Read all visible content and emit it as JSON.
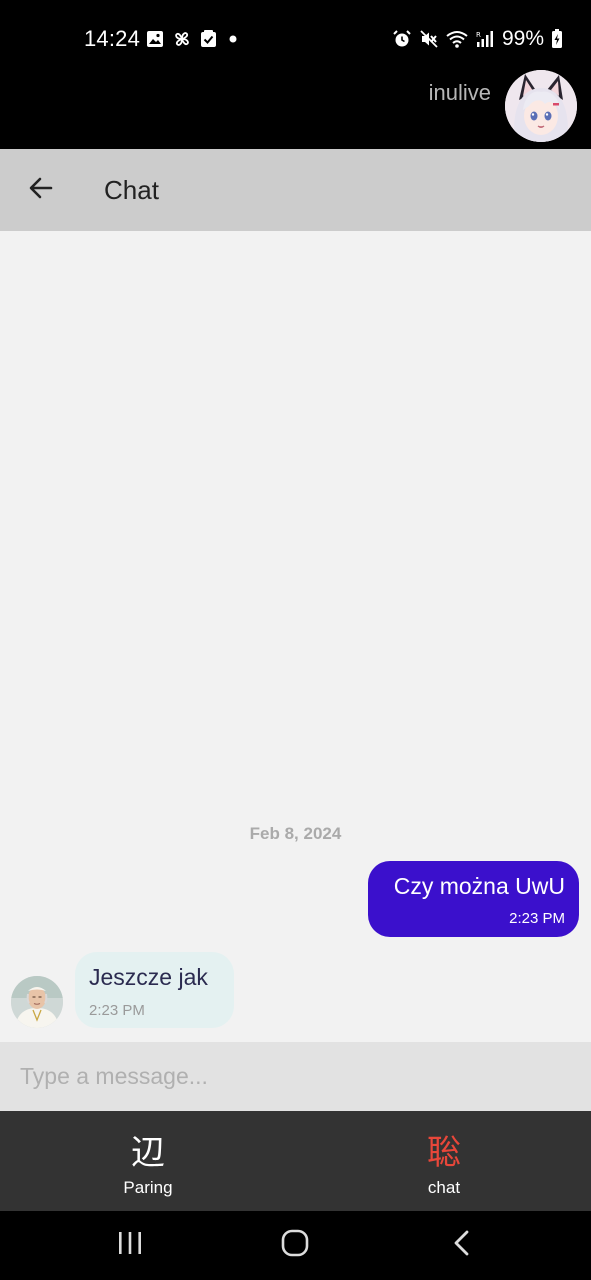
{
  "status_bar": {
    "time": "14:24",
    "battery": "99%",
    "left_icons": [
      "gallery-icon",
      "pinwheel-icon",
      "checkbox-icon",
      "dot-icon"
    ],
    "right_icons": [
      "alarm-icon",
      "mute-icon",
      "wifi-icon",
      "signal-icon",
      "battery-charging-icon"
    ]
  },
  "user": {
    "name": "inulive",
    "avatar_icon": "fox-girl-avatar"
  },
  "app_bar": {
    "title": "Chat",
    "back_icon": "arrow-left-icon"
  },
  "chat": {
    "date": "Feb 8, 2024",
    "messages": [
      {
        "direction": "outgoing",
        "text": "Czy można UwU",
        "time": "2:23 PM"
      },
      {
        "direction": "incoming",
        "text": "Jeszcze jak",
        "time": "2:23 PM"
      }
    ]
  },
  "input": {
    "placeholder": "Type a message..."
  },
  "bottom_nav": {
    "items": [
      {
        "glyph": "辺",
        "label": "Paring"
      },
      {
        "glyph": "聡",
        "label": "chat"
      }
    ]
  },
  "colors": {
    "outgoing_bubble": "#3b10cc",
    "incoming_bubble": "#e4f1f1",
    "active_nav": "#e8473a",
    "app_bar": "#cccccc",
    "nav_background": "#333333"
  },
  "system_nav": {
    "icons": [
      "recents-icon",
      "home-icon",
      "back-icon"
    ]
  }
}
